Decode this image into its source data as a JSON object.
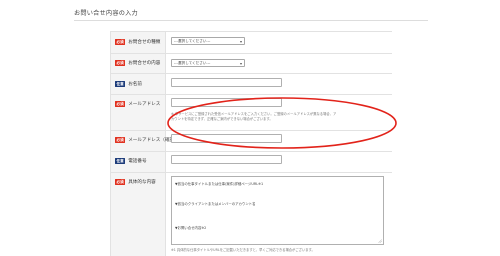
{
  "page": {
    "section_title": "お問い合せ内容の入力"
  },
  "badges": {
    "required": "必須",
    "optional": "任意"
  },
  "form": {
    "fields": [
      {
        "label": "お問合せの種類",
        "badge": "必須"
      },
      {
        "label": "お問合せの内容",
        "badge": "必須"
      },
      {
        "label": "お名前",
        "badge": "任意"
      },
      {
        "label": "メールアドレス",
        "badge": "必須"
      },
      {
        "label": "メールアドレス（確認）",
        "badge": "必須"
      },
      {
        "label": "電話番号",
        "badge": "任意"
      },
      {
        "label": "具体的な内容",
        "badge": "必須"
      }
    ],
    "inquiry_type_select": {
      "selected": "---選択してください---"
    },
    "inquiry_content_select": {
      "selected": "---選択してください---"
    },
    "email_help": [
      "※ 本サービスにご登録された受信メールアドレスをご入力ください。ご登録のメールアドレスが異なる場合、ア",
      "カウントを特定できず、正確なご案内ができない場合がございます。"
    ],
    "details_textarea": {
      "lines": [
        "▼該当の仕事タイトルまたは仕事(案件)詳細ページURL※1",
        "▼該当のクライアントまたはメンバーのアカウント名",
        "▼お問い合せ内容※2"
      ]
    },
    "details_help": "※1 具体的な仕事タイトルやURLをご記載いただきますと、早くご対応できる場合がございます。"
  },
  "colors": {
    "required_badge": "#e0301e",
    "optional_badge": "#1c3b7a",
    "annotation_ellipse": "#e2231a"
  }
}
